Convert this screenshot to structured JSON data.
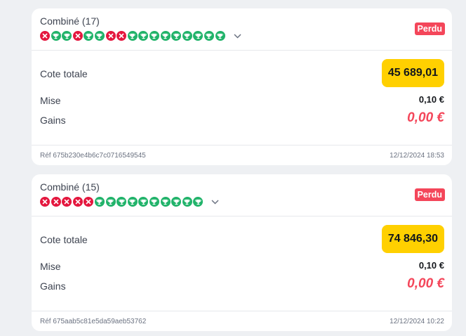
{
  "colors": {
    "lost": "#e4173e",
    "won": "#21b36a",
    "badge": "#f4465a",
    "odds": "#ffd000"
  },
  "bets": [
    {
      "title": "Combiné (17)",
      "status": "Perdu",
      "legs": [
        "lost",
        "won",
        "won",
        "lost",
        "won",
        "won",
        "lost",
        "lost",
        "won",
        "won",
        "won",
        "won",
        "won",
        "won",
        "won",
        "won",
        "won"
      ],
      "odds_label": "Cote totale",
      "odds_value": "45 689,01",
      "stake_label": "Mise",
      "stake_value": "0,10 €",
      "gain_label": "Gains",
      "gain_value": "0,00 €",
      "ref": "Réf 675b230e4b6c7c0716549545",
      "date": "12/12/2024 18:53"
    },
    {
      "title": "Combiné (15)",
      "status": "Perdu",
      "legs": [
        "lost",
        "lost",
        "lost",
        "lost",
        "lost",
        "won",
        "won",
        "won",
        "won",
        "won",
        "won",
        "won",
        "won",
        "won",
        "won"
      ],
      "odds_label": "Cote totale",
      "odds_value": "74 846,30",
      "stake_label": "Mise",
      "stake_value": "0,10 €",
      "gain_label": "Gains",
      "gain_value": "0,00 €",
      "ref": "Réf 675aab5c81e5da59aeb53762",
      "date": "12/12/2024 10:22"
    }
  ],
  "icons": {
    "lost": "cross-icon",
    "won": "trophy-icon",
    "expand": "chevron-down-icon"
  }
}
